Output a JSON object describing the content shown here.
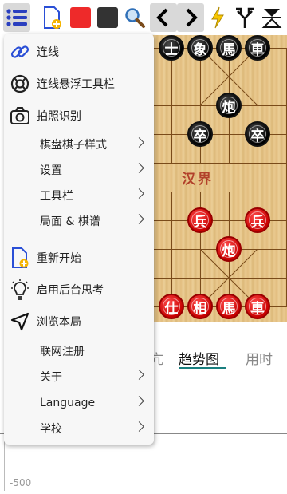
{
  "toolbar": {
    "buttons": [
      {
        "name": "menu-button",
        "icon": "list-menu-icon"
      },
      {
        "name": "new-game-button",
        "icon": "new-file-icon"
      },
      {
        "name": "red-side-button",
        "icon": "red-square-icon"
      },
      {
        "name": "black-side-button",
        "icon": "black-square-icon"
      },
      {
        "name": "search-button",
        "icon": "search-icon"
      },
      {
        "name": "back-button",
        "icon": "chevron-left-icon"
      },
      {
        "name": "forward-button",
        "icon": "chevron-right-icon"
      },
      {
        "name": "flash-button",
        "icon": "lightning-icon"
      },
      {
        "name": "branch-button",
        "icon": "branch-icon"
      },
      {
        "name": "flip-button",
        "icon": "flip-icon"
      }
    ]
  },
  "menu": {
    "items": [
      {
        "label": "连线",
        "icon": "link-icon",
        "submenu": false
      },
      {
        "label": "连线悬浮工具栏",
        "icon": "lifebuoy-icon",
        "submenu": false
      },
      {
        "label": "拍照识别",
        "icon": "camera-icon",
        "submenu": false
      },
      {
        "label": "棋盘棋子样式",
        "icon": "",
        "submenu": true
      },
      {
        "label": "设置",
        "icon": "",
        "submenu": true
      },
      {
        "label": "工具栏",
        "icon": "",
        "submenu": true
      },
      {
        "label": "局面 & 棋谱",
        "icon": "",
        "submenu": true
      },
      {
        "label": "重新开始",
        "icon": "new-file-icon",
        "submenu": false
      },
      {
        "label": "启用后台思考",
        "icon": "lightbulb-icon",
        "submenu": false
      },
      {
        "label": "浏览本局",
        "icon": "navigate-arrow-icon",
        "submenu": false
      },
      {
        "label": "联网注册",
        "icon": "",
        "submenu": false
      },
      {
        "label": "关于",
        "icon": "",
        "submenu": true
      },
      {
        "label": "Language",
        "icon": "",
        "submenu": true
      },
      {
        "label": "学校",
        "icon": "",
        "submenu": true
      }
    ]
  },
  "board": {
    "river_text": "汉界",
    "pieces": [
      {
        "char": "士",
        "side": "black"
      },
      {
        "char": "象",
        "side": "black"
      },
      {
        "char": "馬",
        "side": "black"
      },
      {
        "char": "車",
        "side": "black"
      },
      {
        "char": "炮",
        "side": "black"
      },
      {
        "char": "卒",
        "side": "black"
      },
      {
        "char": "卒",
        "side": "black"
      },
      {
        "char": "兵",
        "side": "red"
      },
      {
        "char": "兵",
        "side": "red"
      },
      {
        "char": "炮",
        "side": "red"
      },
      {
        "char": "仕",
        "side": "red"
      },
      {
        "char": "相",
        "side": "red"
      },
      {
        "char": "馬",
        "side": "red"
      },
      {
        "char": "車",
        "side": "red"
      }
    ]
  },
  "tabs": [
    {
      "label": "亢",
      "active": false
    },
    {
      "label": "趋势图",
      "active": true
    },
    {
      "label": "用时",
      "active": false
    }
  ],
  "chart": {
    "tick_label": "-500"
  },
  "colors": {
    "accent": "#1a7f7f",
    "menu_icon_blue": "#2a4fd6",
    "red_piece": "#d40000",
    "black_piece": "#111111"
  }
}
